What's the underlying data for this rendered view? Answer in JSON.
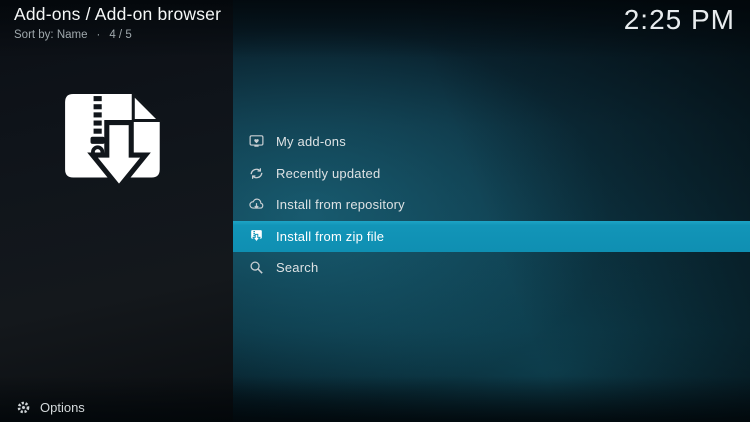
{
  "header": {
    "title": "Add-ons / Add-on browser",
    "sort_label": "Sort by: Name",
    "separator": "·",
    "position": "4 / 5",
    "clock": "2:25 PM"
  },
  "left_pane": {
    "artwork": "zip-file-icon"
  },
  "menu": {
    "items": [
      {
        "label": "My add-ons",
        "icon": "my-addons-icon",
        "selected": false
      },
      {
        "label": "Recently updated",
        "icon": "recently-updated-icon",
        "selected": false
      },
      {
        "label": "Install from repository",
        "icon": "install-from-repository-icon",
        "selected": false
      },
      {
        "label": "Install from zip file",
        "icon": "install-from-zip-icon",
        "selected": true
      },
      {
        "label": "Search",
        "icon": "search-icon",
        "selected": false
      }
    ]
  },
  "footer": {
    "options_label": "Options"
  },
  "colors": {
    "highlight": "#1295b8",
    "background_teal": "#0e3a4a",
    "left_pane_dark": "#10151b",
    "text_primary": "#f6f8f8",
    "text_secondary": "#9fa8ac",
    "icon_gray": "#c9cfd3"
  }
}
